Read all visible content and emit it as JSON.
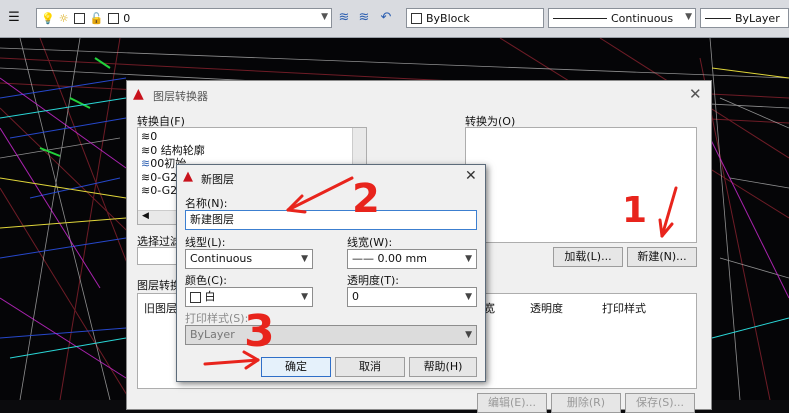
{
  "toolbar": {
    "layer_value": "0",
    "color_value": "ByBlock",
    "linetype_value": "Continuous",
    "lineweight_value": "ByLayer"
  },
  "main_dialog": {
    "title": "图层转换器",
    "convert_from_label": "转换自(F)",
    "convert_from_items": [
      "0",
      "0 结构轮廓",
      "00初始",
      "0-G2",
      "0-G2"
    ],
    "selection_filter_label": "选择过滤",
    "convert_to_label": "转换为(O)",
    "load_button": "加载(L)...",
    "new_button": "新建(N)...",
    "mapping_label": "图层转换",
    "mapping_columns": [
      "旧图层",
      "宽",
      "透明度",
      "打印样式"
    ],
    "bottom_buttons": [
      "编辑(E)...",
      "删除(R)",
      "保存(S)..."
    ]
  },
  "new_layer_dialog": {
    "title": "新图层",
    "name_label": "名称(N):",
    "name_value": "新建图层",
    "linetype_label": "线型(L):",
    "linetype_value": "Continuous",
    "lineweight_label": "线宽(W):",
    "lineweight_value": "—— 0.00 mm",
    "color_label": "颜色(C):",
    "color_value": "白",
    "transparency_label": "透明度(T):",
    "transparency_value": "0",
    "plot_style_label": "打印样式(S):",
    "plot_style_value": "ByLayer",
    "ok_button": "确定",
    "cancel_button": "取消",
    "help_button": "帮助(H)"
  },
  "annotations": [
    "1",
    "2",
    "3"
  ],
  "colors": {
    "annotation": "#e8241c",
    "cad_background": "#050507",
    "dialog_bg": "#f0f0f0"
  }
}
